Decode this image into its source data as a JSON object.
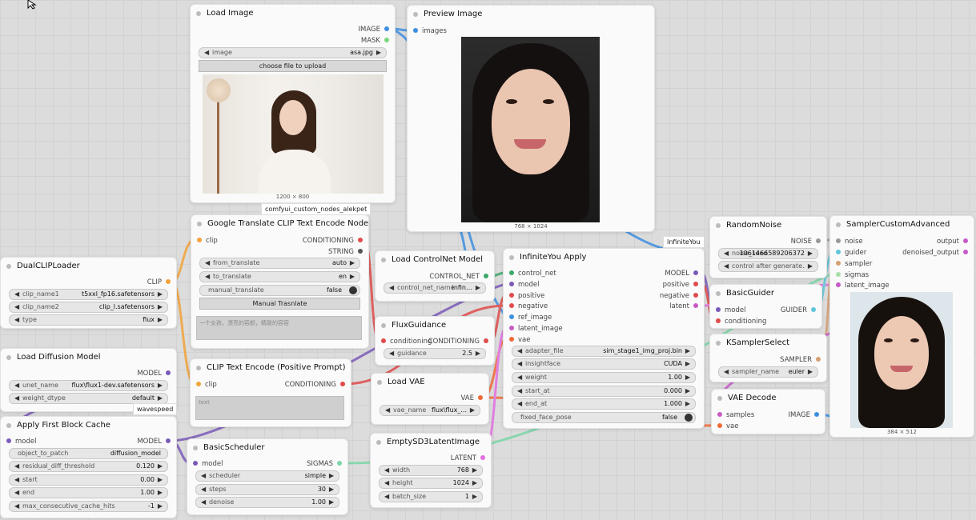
{
  "colors": {
    "image": "#3d8fe0",
    "mask": "#7cd67c",
    "clip": "#f2a33a",
    "conditioning": "#e04b4b",
    "model": "#7a5ab8",
    "sigmas": "#7bd6a8",
    "latent": "#e36fe3",
    "vae": "#f06a37",
    "control_net": "#3aa86a"
  },
  "load_image": {
    "title": "Load Image",
    "out_image": "IMAGE",
    "out_mask": "MASK",
    "w_image_label": "image",
    "w_image_value": "asa.jpg",
    "upload_button": "choose file to upload",
    "dims": "1200 × 800"
  },
  "preview": {
    "title": "Preview Image",
    "in_images": "images",
    "dims": "768 × 1024"
  },
  "badges": {
    "alekpet": "comfyui_custom_nodes_alekpet",
    "infiniteyou": "InfiniteYou",
    "wavespeed": "wavespeed"
  },
  "dualclip": {
    "title": "DualCLIPLoader",
    "out": "CLIP",
    "w1_label": "clip_name1",
    "w1_value": "t5xxl_fp16.safetensors",
    "w2_label": "clip_name2",
    "w2_value": "clip_l.safetensors",
    "w3_label": "type",
    "w3_value": "flux"
  },
  "google": {
    "title": "Google Translate CLIP Text Encode Node",
    "in_clip": "clip",
    "out_cond": "CONDITIONING",
    "out_str": "STRING",
    "w1_label": "from_translate",
    "w1_value": "auto",
    "w2_label": "to_translate",
    "w2_value": "en",
    "w3_label": "manual_translate",
    "w3_value": "false",
    "button": "Manual Trasnlate",
    "text": "一个女孩，漂亮的容颜，精致的容容"
  },
  "loadcn": {
    "title": "Load ControlNet Model",
    "out": "CONTROL_NET",
    "w1_label": "control_net_name",
    "w1_value": "infin…"
  },
  "infapply": {
    "title": "InfiniteYou Apply",
    "in": [
      "control_net",
      "model",
      "positive",
      "negative",
      "ref_image",
      "latent_image",
      "vae"
    ],
    "out": [
      "MODEL",
      "positive",
      "negative",
      "latent"
    ],
    "w1_label": "adapter_file",
    "w1_value": "sim_stage1_img_proj.bin",
    "w2_label": "insightface",
    "w2_value": "CUDA",
    "w3_label": "weight",
    "w3_value": "1.00",
    "w4_label": "start_at",
    "w4_value": "0.000",
    "w5_label": "end_at",
    "w5_value": "1.000",
    "w6_label": "fixed_face_pose",
    "w6_value": "false"
  },
  "randnoise": {
    "title": "RandomNoise",
    "out": "NOISE",
    "w1_label": "noise_seed",
    "w1_value": "1061466589206372",
    "w2_label": "control after generate",
    "w2_value": "."
  },
  "guider": {
    "title": "BasicGuider",
    "in_model": "model",
    "in_cond": "conditioning",
    "out": "GUIDER"
  },
  "ksel": {
    "title": "KSamplerSelect",
    "out": "SAMPLER",
    "w1_label": "sampler_name",
    "w1_value": "euler"
  },
  "vaedec": {
    "title": "VAE Decode",
    "in_samples": "samples",
    "in_vae": "vae",
    "out": "IMAGE"
  },
  "sca": {
    "title": "SamplerCustomAdvanced",
    "in": [
      "noise",
      "guider",
      "sampler",
      "sigmas",
      "latent_image"
    ],
    "out": [
      "output",
      "denoised_output"
    ],
    "dims": "384 × 512"
  },
  "loaddiff": {
    "title": "Load Diffusion Model",
    "out": "MODEL",
    "w1_label": "unet_name",
    "w1_value": "flux\\flux1-dev.safetensors",
    "w2_label": "weight_dtype",
    "w2_value": "default"
  },
  "clipenc": {
    "title": "CLIP Text Encode (Positive Prompt)",
    "in_clip": "clip",
    "out": "CONDITIONING",
    "text": "text"
  },
  "fluxg": {
    "title": "FluxGuidance",
    "in": "conditioning",
    "out": "CONDITIONING",
    "w1_label": "guidance",
    "w1_value": "2.5"
  },
  "loadvae": {
    "title": "Load VAE",
    "out": "VAE",
    "w1_label": "vae_name",
    "w1_value": "flux\\flux_..."
  },
  "fbcache": {
    "title": "Apply First Block Cache",
    "in": "model",
    "out": "MODEL",
    "w1_label": "object_to_patch",
    "w1_value": "diffusion_model",
    "w2_label": "residual_diff_threshold",
    "w2_value": "0.120",
    "w3_label": "start",
    "w3_value": "0.00",
    "w4_label": "end",
    "w4_value": "1.00",
    "w5_label": "max_consecutive_cache_hits",
    "w5_value": "-1"
  },
  "bsched": {
    "title": "BasicScheduler",
    "in": "model",
    "out": "SIGMAS",
    "w1_label": "scheduler",
    "w1_value": "simple",
    "w2_label": "steps",
    "w2_value": "30",
    "w3_label": "denoise",
    "w3_value": "1.00"
  },
  "empty": {
    "title": "EmptySD3LatentImage",
    "out": "LATENT",
    "w1_label": "width",
    "w1_value": "768",
    "w2_label": "height",
    "w2_value": "1024",
    "w3_label": "batch_size",
    "w3_value": "1"
  }
}
